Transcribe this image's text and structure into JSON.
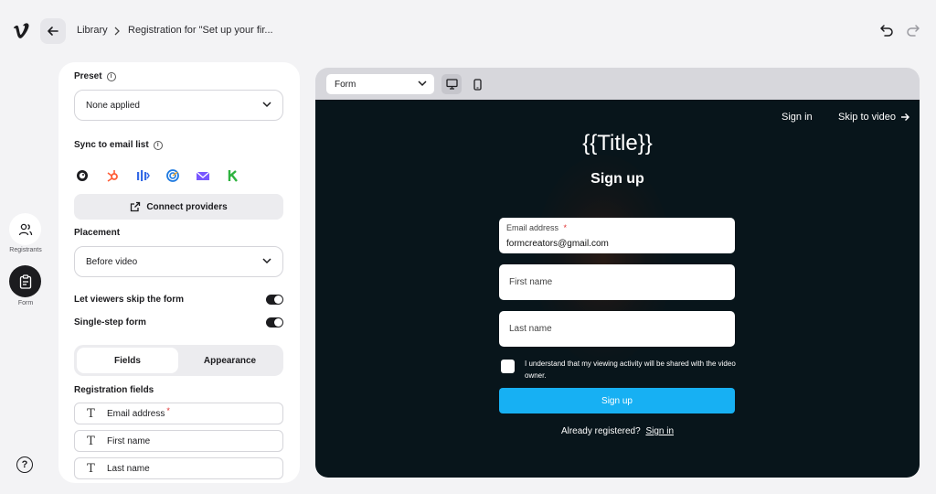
{
  "header": {
    "breadcrumb_library": "Library",
    "breadcrumb_page": "Registration for \"Set up your fir..."
  },
  "rail": {
    "registrants_label": "Registrants",
    "form_label": "Form"
  },
  "panel": {
    "preset_label": "Preset",
    "preset_value": "None applied",
    "sync_label": "Sync to email list",
    "providers": [
      "mailchimp-icon",
      "hubspot-icon",
      "activecampaign-icon",
      "constant-contact-icon",
      "campaign-monitor-icon",
      "klaviyo-icon"
    ],
    "connect_label": "Connect providers",
    "placement_label": "Placement",
    "placement_value": "Before video",
    "skip_label": "Let viewers skip the form",
    "single_step_label": "Single-step form",
    "tabs": [
      "Fields",
      "Appearance"
    ],
    "reg_fields_label": "Registration fields",
    "fields": [
      {
        "label": "Email address",
        "required": "*"
      },
      {
        "label": "First name"
      },
      {
        "label": "Last name"
      }
    ]
  },
  "preview": {
    "form_select": "Form",
    "sign_in": "Sign in",
    "skip_to_video": "Skip to video",
    "title": "{{Title}}",
    "subtitle": "Sign up",
    "email_label": "Email address",
    "email_required": "*",
    "email_value": "formcreators@gmail.com",
    "first_name_placeholder": "First name",
    "last_name_placeholder": "Last name",
    "consent_text": "I understand that my viewing activity will be shared with the video owner.",
    "signup_button": "Sign up",
    "already_text": "Already registered?",
    "already_link": "Sign in"
  },
  "colors": {
    "accent_blue": "#17b0f3",
    "video_bg": "#08151b",
    "required_red": "#e03131"
  }
}
